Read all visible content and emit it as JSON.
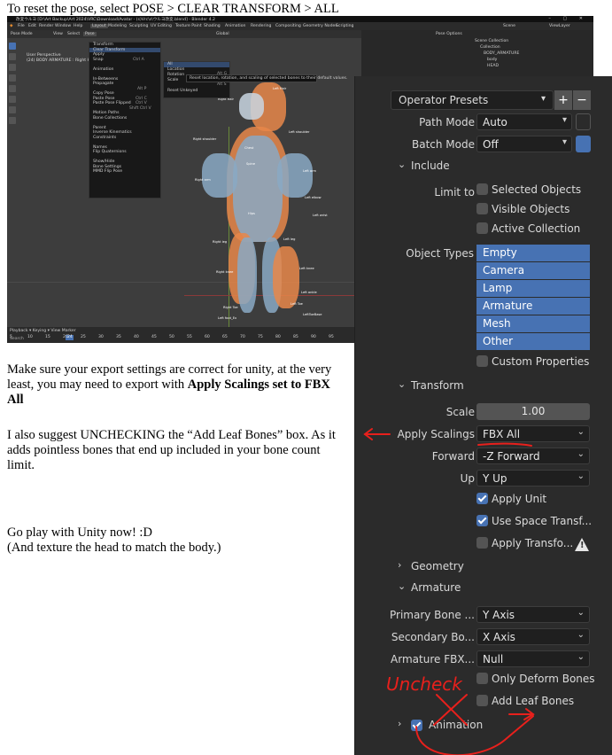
{
  "doc": {
    "line1": "To reset the pose, select POSE > CLEAR TRANSFORM > ALL",
    "para1_pre": "Make sure your export settings are correct for unity, at the very least, you may need to export with ",
    "para1_bold": "Apply Scalings set to FBX All",
    "para2": "I also suggest UNCHECKING the “Add Leaf Bones” box. As it adds pointless bones that end up included in your bone count limit.",
    "para3_line1": "Go play with Unity now! :D",
    "para3_line2": "(And texture the head to match the body.)"
  },
  "blender": {
    "title": "改変ウルヨ [D:\\Art Backup\\Art 2024\\VRC\\Download\\Avatar - (s)Vrc\\s\\ウルヨ改変.blend] - Blender 4.2",
    "window_controls": "–  ▢  ✕",
    "menubar": [
      "File",
      "Edit",
      "Render",
      "Window",
      "Help"
    ],
    "workspace_tabs": [
      "Layout",
      "Modeling",
      "Sculpting",
      "UV Editing",
      "Texture Paint",
      "Shading",
      "Animation",
      "Rendering",
      "Compositing",
      "Geometry Nodes",
      "Scripting"
    ],
    "active_tab": "Layout",
    "scene_label": "Scene",
    "view_layer_label": "ViewLayer",
    "header_items": [
      "Pose Mode",
      "View",
      "Select",
      "Pose"
    ],
    "transform_orientation": "Global",
    "viewport_info": [
      "User Perspective",
      "(24) BODY ARMATURE : Right Hair"
    ],
    "pose_menu": [
      "Transform",
      "Clear Transform",
      "Apply",
      "Snap",
      "",
      "Animation",
      "",
      "In-Betweens",
      "Propagate",
      "",
      "Copy Pose",
      "Paste Pose",
      "Paste Pose Flipped",
      "",
      "Motion Paths",
      "Bone Collections",
      "",
      "Parent",
      "Inverse Kinematics",
      "Constraints",
      "",
      "Names",
      "Flip Quaternions",
      "",
      "Show/Hide",
      "Bone Settings",
      "MMD Flip Pose"
    ],
    "pose_menu_shortcuts": [
      "",
      "",
      "Ctrl A",
      "",
      "",
      "",
      "",
      "",
      "Alt P",
      "",
      "Ctrl C",
      "Ctrl V",
      "Shift Ctrl V"
    ],
    "clear_submenu": [
      "All",
      "Location",
      "Rotation",
      "Scale",
      "Reset Unkeyed"
    ],
    "clear_submenu_shortcuts": [
      "",
      "Alt G",
      "Alt R",
      "Alt S",
      ""
    ],
    "tooltip": "Reset location, rotation, and scaling of selected bones to their default values.",
    "bone_labels": [
      "Left Hair",
      "Right Hair",
      "Left shoulder",
      "Right shoulder",
      "Left arm",
      "Right arm",
      "Left elbow",
      "Left wrist",
      "Spine",
      "Chest",
      "Hips",
      "Left leg",
      "Right leg",
      "Left knee",
      "Right knee",
      "Left ankle",
      "Left Toe",
      "Right Toe",
      "LeftToeBase",
      "Left foot_Ex"
    ],
    "timeline_controls": "Playback ▾   Keying ▾   View   Marker",
    "timeline_frames": [
      "5",
      "10",
      "15",
      "20",
      "25",
      "30",
      "35",
      "40",
      "45",
      "50",
      "55",
      "60",
      "65",
      "70",
      "75",
      "80",
      "85",
      "90",
      "95"
    ],
    "current_frame": "24",
    "status_bar": "Search",
    "outliner_header": "Pose Options",
    "outliner_items": [
      "Scene Collection",
      "Collection",
      "BODY_ARMATURE",
      "body",
      "HEAD"
    ]
  },
  "export_panel": {
    "operator_presets": "Operator Presets",
    "path_mode_label": "Path Mode",
    "path_mode_value": "Auto",
    "batch_mode_label": "Batch Mode",
    "batch_mode_value": "Off",
    "include_section": "Include",
    "limit_to_label": "Limit to",
    "limit_options": [
      "Selected Objects",
      "Visible Objects",
      "Active Collection"
    ],
    "object_types_label": "Object Types",
    "object_types": [
      "Empty",
      "Camera",
      "Lamp",
      "Armature",
      "Mesh",
      "Other"
    ],
    "custom_properties": "Custom Properties",
    "transform_section": "Transform",
    "scale_label": "Scale",
    "scale_value": "1.00",
    "apply_scalings_label": "Apply Scalings",
    "apply_scalings_value": "FBX All",
    "forward_label": "Forward",
    "forward_value": "-Z Forward",
    "up_label": "Up",
    "up_value": "Y Up",
    "apply_unit": "Apply Unit",
    "use_space_transform": "Use Space Transf...",
    "apply_transform": "Apply Transfo...",
    "geometry_section": "Geometry",
    "armature_section": "Armature",
    "primary_bone_label": "Primary Bone ...",
    "primary_bone_value": "Y Axis",
    "secondary_bone_label": "Secondary Bo...",
    "secondary_bone_value": "X Axis",
    "armature_fbx_label": "Armature FBX...",
    "armature_fbx_value": "Null",
    "only_deform_bones": "Only Deform Bones",
    "add_leaf_bones": "Add Leaf Bones",
    "animation_section": "Animation",
    "annotation_text": "Uncheck"
  },
  "colors": {
    "blender_accent": "#4772b3",
    "panel_bg": "#2b2b2b",
    "annotation_red": "#e8201c"
  }
}
